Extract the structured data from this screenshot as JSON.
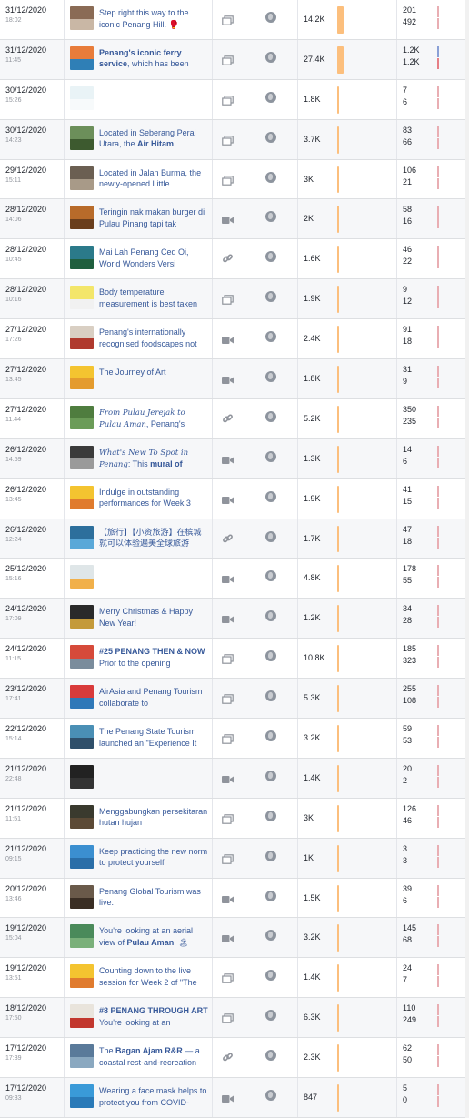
{
  "colors": {
    "reach_bar": "#fcbf7d",
    "reach_bar_faint": "#fde2c4",
    "engagement_bar_top": "#e9aeb3",
    "engagement_bar_bottom": "#e9aeb3",
    "link_text": "#365899"
  },
  "icons": {
    "type_photo": "photo-icon",
    "type_video": "video-camera-icon",
    "type_link": "link-icon",
    "privacy": "globe-icon"
  },
  "posts": [
    {
      "date": "31/12/2020",
      "time": "18:02",
      "text_html": "Step right this way to the iconic Penang Hill. 🥊",
      "type": "photo",
      "reach": "14.2K",
      "reach_level": 0.35,
      "eng_top": "201",
      "eng_bottom": "492",
      "thumb": [
        "#8a6b55",
        "#c9b7a5"
      ]
    },
    {
      "date": "31/12/2020",
      "time": "11:45",
      "text_html": "<b>Penang's iconic ferry service</b>, which has been",
      "type": "photo",
      "reach": "27.4K",
      "reach_level": 0.7,
      "eng_top": "1.2K",
      "eng_bottom": "1.2K",
      "thumb": [
        "#e87c3a",
        "#2f7fb6"
      ],
      "eng_colors": [
        "#8aa0d6",
        "#e67f86"
      ]
    },
    {
      "date": "30/12/2020",
      "time": "15:26",
      "text_html": "",
      "type": "photo",
      "reach": "1.8K",
      "reach_level": 0.05,
      "eng_top": "7",
      "eng_bottom": "6",
      "thumb": [
        "#e9f3f6",
        "#f7fafb"
      ]
    },
    {
      "date": "30/12/2020",
      "time": "14:23",
      "text_html": "Located in Seberang Perai Utara, the <b>Air Hitam</b>",
      "type": "photo",
      "reach": "3.7K",
      "reach_level": 0.1,
      "eng_top": "83",
      "eng_bottom": "66",
      "thumb": [
        "#6c8f5a",
        "#3d5a2f"
      ]
    },
    {
      "date": "29/12/2020",
      "time": "15:11",
      "text_html": "Located in Jalan Burma, the newly-opened Little",
      "type": "photo",
      "reach": "3K",
      "reach_level": 0.08,
      "eng_top": "106",
      "eng_bottom": "21",
      "thumb": [
        "#6b5f52",
        "#a89a88"
      ]
    },
    {
      "date": "28/12/2020",
      "time": "14:06",
      "text_html": "Teringin nak makan burger di Pulau Pinang tapi tak",
      "type": "video",
      "reach": "2K",
      "reach_level": 0.06,
      "eng_top": "58",
      "eng_bottom": "16",
      "thumb": [
        "#b86b2a",
        "#6a3e1c"
      ]
    },
    {
      "date": "28/12/2020",
      "time": "10:45",
      "text_html": "Mai Lah Penang Ceq Oi, World Wonders Versi",
      "type": "link",
      "reach": "1.6K",
      "reach_level": 0.05,
      "eng_top": "46",
      "eng_bottom": "22",
      "thumb": [
        "#2b7a8a",
        "#1f5f3e"
      ]
    },
    {
      "date": "28/12/2020",
      "time": "10:16",
      "text_html": "Body temperature measurement is best taken",
      "type": "photo",
      "reach": "1.9K",
      "reach_level": 0.05,
      "eng_top": "9",
      "eng_bottom": "12",
      "thumb": [
        "#f3e66a",
        "#f1f1f1"
      ]
    },
    {
      "date": "27/12/2020",
      "time": "17:26",
      "text_html": "Penang's internationally recognised foodscapes not",
      "type": "video",
      "reach": "2.4K",
      "reach_level": 0.07,
      "eng_top": "91",
      "eng_bottom": "18",
      "thumb": [
        "#d9cfc3",
        "#b03a2e"
      ]
    },
    {
      "date": "27/12/2020",
      "time": "13:45",
      "text_html": "The Journey of Art",
      "type": "video",
      "reach": "1.8K",
      "reach_level": 0.05,
      "eng_top": "31",
      "eng_bottom": "9",
      "thumb": [
        "#f4c430",
        "#e49b2e"
      ]
    },
    {
      "date": "27/12/2020",
      "time": "11:44",
      "text_html": "<i>From Pulau Jerejak to Pulau Aman</i>, Penang's",
      "type": "link",
      "reach": "5.2K",
      "reach_level": 0.14,
      "eng_top": "350",
      "eng_bottom": "235",
      "thumb": [
        "#4f7d3f",
        "#6b9c58"
      ]
    },
    {
      "date": "26/12/2020",
      "time": "14:59",
      "text_html": "<i>What's New To Spot in Penang</i>: This <b>mural of</b>",
      "type": "video",
      "reach": "1.3K",
      "reach_level": 0.04,
      "eng_top": "14",
      "eng_bottom": "6",
      "thumb": [
        "#3b3b3b",
        "#9a9a9a"
      ]
    },
    {
      "date": "26/12/2020",
      "time": "13:45",
      "text_html": "Indulge in outstanding performances for Week 3",
      "type": "video",
      "reach": "1.9K",
      "reach_level": 0.05,
      "eng_top": "41",
      "eng_bottom": "15",
      "thumb": [
        "#f4c430",
        "#e07b2e"
      ]
    },
    {
      "date": "26/12/2020",
      "time": "12:24",
      "text_html": "【旅行】【小资旅游】在槟城就可以体验遍美全球旅游",
      "type": "link",
      "reach": "1.7K",
      "reach_level": 0.05,
      "eng_top": "47",
      "eng_bottom": "18",
      "thumb": [
        "#2d6f9c",
        "#5aa8d8"
      ]
    },
    {
      "date": "25/12/2020",
      "time": "15:16",
      "text_html": "",
      "type": "video",
      "reach": "4.8K",
      "reach_level": 0.13,
      "eng_top": "178",
      "eng_bottom": "55",
      "thumb": [
        "#dfe6e8",
        "#f1b04a"
      ]
    },
    {
      "date": "24/12/2020",
      "time": "17:09",
      "text_html": "Merry Christmas &amp; Happy New Year!",
      "type": "video",
      "reach": "1.2K",
      "reach_level": 0.04,
      "eng_top": "34",
      "eng_bottom": "28",
      "thumb": [
        "#2a2a2a",
        "#c49a3a"
      ]
    },
    {
      "date": "24/12/2020",
      "time": "11:15",
      "text_html": "<b>#25 PENANG THEN &amp; NOW</b> Prior to the opening",
      "type": "photo",
      "reach": "10.8K",
      "reach_level": 0.28,
      "eng_top": "185",
      "eng_bottom": "323",
      "thumb": [
        "#d64a3a",
        "#7a8c9c"
      ]
    },
    {
      "date": "23/12/2020",
      "time": "17:41",
      "text_html": "AirAsia and Penang Tourism collaborate to",
      "type": "photo",
      "reach": "5.3K",
      "reach_level": 0.14,
      "eng_top": "255",
      "eng_bottom": "108",
      "thumb": [
        "#d93b3b",
        "#2f78b8"
      ]
    },
    {
      "date": "22/12/2020",
      "time": "15:14",
      "text_html": "The Penang State Tourism launched an \"Experience It",
      "type": "photo",
      "reach": "3.2K",
      "reach_level": 0.09,
      "eng_top": "59",
      "eng_bottom": "53",
      "thumb": [
        "#4a8fb5",
        "#2f4f6a"
      ]
    },
    {
      "date": "21/12/2020",
      "time": "22:48",
      "text_html": "",
      "type": "video",
      "reach": "1.4K",
      "reach_level": 0.04,
      "eng_top": "20",
      "eng_bottom": "2",
      "thumb": [
        "#222222",
        "#333333"
      ]
    },
    {
      "date": "21/12/2020",
      "time": "11:51",
      "text_html": "Menggabungkan persekitaran hutan hujan",
      "type": "photo",
      "reach": "3K",
      "reach_level": 0.08,
      "eng_top": "126",
      "eng_bottom": "46",
      "thumb": [
        "#3a3a2e",
        "#5c4a36"
      ]
    },
    {
      "date": "21/12/2020",
      "time": "09:15",
      "text_html": "Keep practicing the new norm to protect yourself",
      "type": "photo",
      "reach": "1K",
      "reach_level": 0.03,
      "eng_top": "3",
      "eng_bottom": "3",
      "thumb": [
        "#3b8fd0",
        "#2a6ea8"
      ]
    },
    {
      "date": "20/12/2020",
      "time": "13:46",
      "text_html": "Penang Global Tourism was live.",
      "type": "video",
      "reach": "1.5K",
      "reach_level": 0.04,
      "eng_top": "39",
      "eng_bottom": "6",
      "thumb": [
        "#6a5a4a",
        "#3a2e24"
      ]
    },
    {
      "date": "19/12/2020",
      "time": "15:04",
      "text_html": "You're looking at an aerial view of <b>Pulau Aman</b>. 🏝",
      "type": "video",
      "reach": "3.2K",
      "reach_level": 0.09,
      "eng_top": "145",
      "eng_bottom": "68",
      "thumb": [
        "#4a8a5a",
        "#7ab07a"
      ]
    },
    {
      "date": "19/12/2020",
      "time": "13:51",
      "text_html": "Counting down to the live session for Week 2 of \"The",
      "type": "photo",
      "reach": "1.4K",
      "reach_level": 0.04,
      "eng_top": "24",
      "eng_bottom": "7",
      "thumb": [
        "#f4c430",
        "#e07b2e"
      ]
    },
    {
      "date": "18/12/2020",
      "time": "17:50",
      "text_html": "<b>#8 PENANG THROUGH ART</b> You're looking at an",
      "type": "photo",
      "reach": "6.3K",
      "reach_level": 0.17,
      "eng_top": "110",
      "eng_bottom": "249",
      "thumb": [
        "#e9e4dc",
        "#c2372e"
      ]
    },
    {
      "date": "17/12/2020",
      "time": "17:39",
      "text_html": "The <b>Bagan Ajam R&amp;R</b> — a coastal rest-and-recreation",
      "type": "link",
      "reach": "2.3K",
      "reach_level": 0.06,
      "eng_top": "62",
      "eng_bottom": "50",
      "thumb": [
        "#5a7a9a",
        "#8aa8c0"
      ]
    },
    {
      "date": "17/12/2020",
      "time": "09:33",
      "text_html": "Wearing a face mask helps to protect you from COVID-",
      "type": "video",
      "reach": "847",
      "reach_level": 0.02,
      "eng_top": "5",
      "eng_bottom": "0",
      "thumb": [
        "#3a9ad8",
        "#2a7ab8"
      ]
    }
  ]
}
